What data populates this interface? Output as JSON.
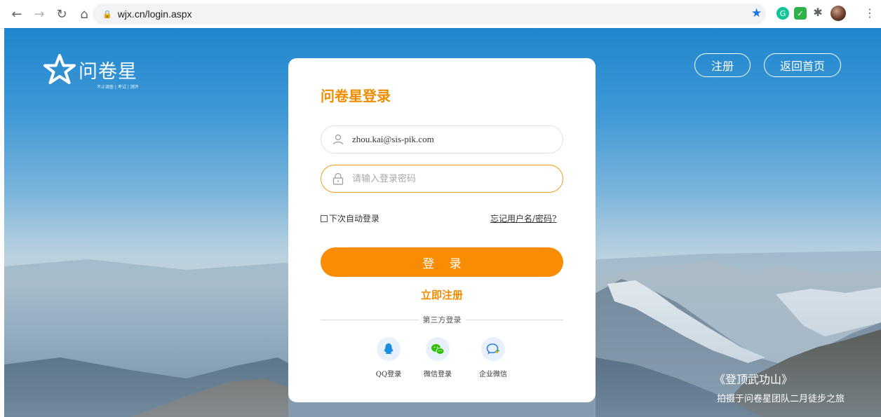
{
  "browser": {
    "url": "wjx.cn/login.aspx",
    "nav_icons": [
      "back-arrow-icon",
      "forward-arrow-icon",
      "reload-icon",
      "home-icon"
    ]
  },
  "header": {
    "logo_text": "问卷星",
    "logo_sub": "不止调查 | 考试 | 测评",
    "register_button": "注册",
    "home_button": "返回首页"
  },
  "login": {
    "title": "问卷星登录",
    "username_value": "zhou.kai@sis-pik.com",
    "password_placeholder": "请输入登录密码",
    "remember_label": "下次自动登录",
    "forgot_link": "忘记用户名/密码?",
    "login_button": "登 录",
    "signup_link": "立即注册",
    "third_party_label": "第三方登录",
    "social": [
      {
        "label": "QQ登录",
        "icon": "qq-icon"
      },
      {
        "label": "微信登录",
        "icon": "wechat-icon"
      },
      {
        "label": "企业微信",
        "icon": "wecom-icon"
      }
    ]
  },
  "caption": {
    "title": "《登顶武功山》",
    "subtitle": "拍摄于问卷星团队二月徒步之旅"
  },
  "colors": {
    "accent": "#fa8c04",
    "title_orange": "#f08c00"
  }
}
